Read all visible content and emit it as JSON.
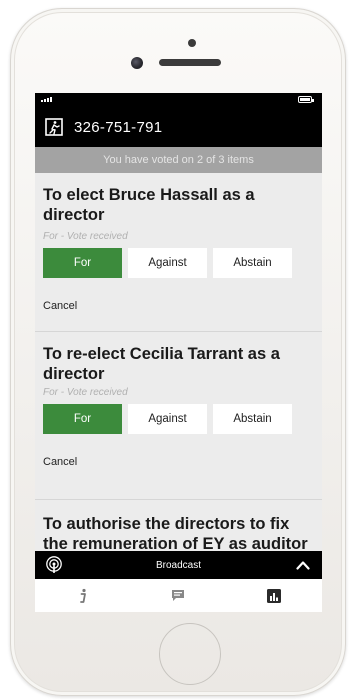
{
  "header": {
    "meeting_id": "326-751-791"
  },
  "vote_summary": "You have voted on 2 of 3 items",
  "items": [
    {
      "title": "To elect Bruce Hassall as a director",
      "status": "For - Vote received",
      "choices": [
        "For",
        "Against",
        "Abstain"
      ],
      "selected": "For",
      "cancel": "Cancel"
    },
    {
      "title": "To re-elect Cecilia Tarrant as a director",
      "status": "For - Vote received",
      "choices": [
        "For",
        "Against",
        "Abstain"
      ],
      "selected": "For",
      "cancel": "Cancel"
    },
    {
      "title": "To authorise the directors to fix the remuneration of EY as auditor for the ensuing year"
    }
  ],
  "broadcast": {
    "label": "Broadcast"
  },
  "tabs": [
    {
      "icon": "info-icon"
    },
    {
      "icon": "chat-icon"
    },
    {
      "icon": "results-chart-icon"
    }
  ],
  "colors": {
    "accent_green": "#3c8b3c",
    "header_bg": "#000000",
    "vote_bar_bg": "#a3a3a3"
  }
}
